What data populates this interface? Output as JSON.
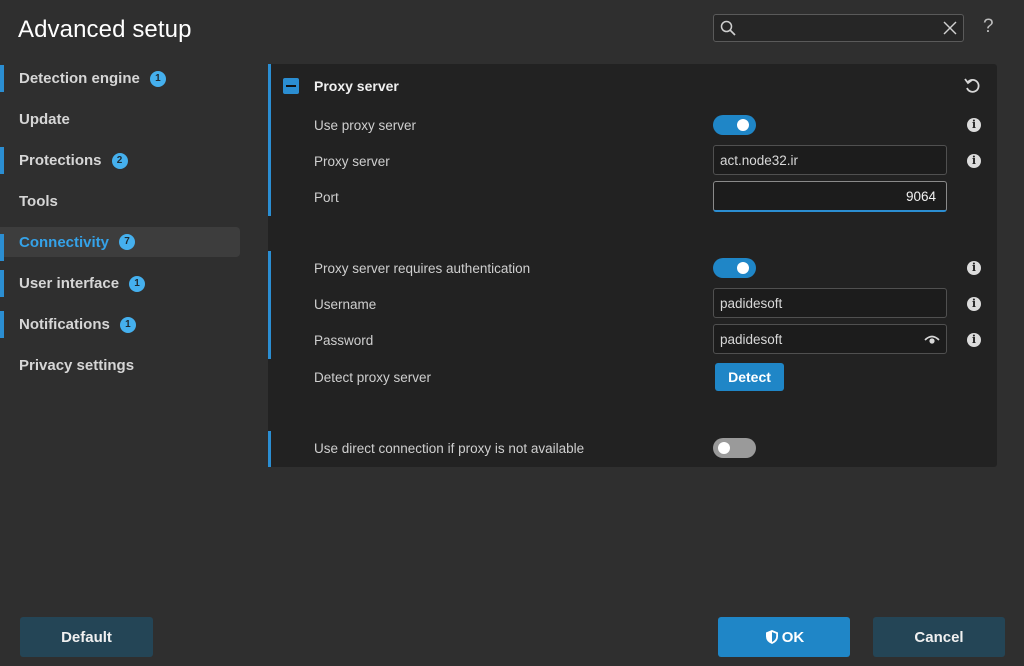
{
  "window": {
    "title": "Advanced setup",
    "help_label": "?"
  },
  "search": {
    "value": "",
    "placeholder": ""
  },
  "sidebar": {
    "items": [
      {
        "label": "Detection engine",
        "badge": "1"
      },
      {
        "label": "Update",
        "badge": ""
      },
      {
        "label": "Protections",
        "badge": "2"
      },
      {
        "label": "Tools",
        "badge": ""
      },
      {
        "label": "Connectivity",
        "badge": "7"
      },
      {
        "label": "User interface",
        "badge": "1"
      },
      {
        "label": "Notifications",
        "badge": "1"
      },
      {
        "label": "Privacy settings",
        "badge": ""
      }
    ]
  },
  "section": {
    "title": "Proxy server",
    "use_proxy_label": "Use proxy server",
    "use_proxy_on": true,
    "proxy_server_label": "Proxy server",
    "proxy_server_value": "act.node32.ir",
    "port_label": "Port",
    "port_value": "9064",
    "auth_label": "Proxy server requires authentication",
    "auth_on": true,
    "username_label": "Username",
    "username_value": "padidesoft",
    "password_label": "Password",
    "password_value": "padidesoft",
    "detect_label": "Detect proxy server",
    "detect_button": "Detect",
    "direct_label": "Use direct connection if proxy is not available",
    "direct_on": false,
    "info_glyph": "i"
  },
  "footer": {
    "default_label": "Default",
    "ok_label": "OK",
    "cancel_label": "Cancel"
  },
  "colors": {
    "accent": "#2b8ed2",
    "badge": "#45b0ee",
    "button_primary": "#1f86c7",
    "button_secondary": "#244556",
    "panel": "#222222",
    "background": "#2f2f2f"
  }
}
